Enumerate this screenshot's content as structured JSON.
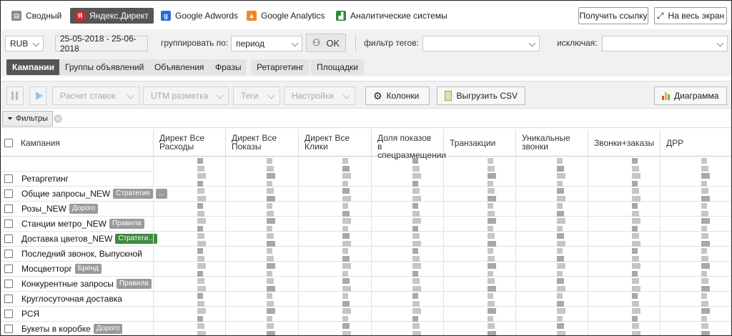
{
  "sources": {
    "tabs": [
      {
        "label": "Сводный",
        "icon": "summary-icon"
      },
      {
        "label": "Яндекс.Директ",
        "icon": "yandex-icon"
      },
      {
        "label": "Google Adwords",
        "icon": "google-icon"
      },
      {
        "label": "Google Analytics",
        "icon": "analytics-icon"
      },
      {
        "label": "Аналитические системы",
        "icon": "analytics-systems-icon"
      }
    ],
    "active": "Яндекс.Директ"
  },
  "header_buttons": {
    "get_link": "Получить ссылку",
    "fullscreen": "На весь экран"
  },
  "filters": {
    "currency": "RUB",
    "date_range": "25-05-2018 - 25-06-2018",
    "group_by_label": "группировать по:",
    "group_by_value": "период",
    "ok_label": "OK",
    "tag_filter_label": "фильтр тегов:",
    "tag_filter_value": "",
    "exclude_label": "исключая:",
    "exclude_value": ""
  },
  "subtabs": {
    "items": [
      "Кампании",
      "Группы объявлений",
      "Объявления",
      "Фразы",
      "Ретаргетинг",
      "Площадки"
    ],
    "active": "Кампании"
  },
  "toolbar": {
    "bid_calc": "Расчет ставок",
    "utm": "UTM разметка",
    "tags": "Теги",
    "settings": "Настройки",
    "columns": "Колонки",
    "export_csv": "Выгрузить CSV",
    "chart": "Диаграмма"
  },
  "filter_chip": {
    "label": "Фильтры"
  },
  "table": {
    "columns": [
      "Кампания",
      "Директ Все Расходы",
      "Директ Все Показы",
      "Директ Все Клики",
      "Доля показов в спецразмещении",
      "Транзакции",
      "Уникальные звонки",
      "Звонки+заказы",
      "ДРР"
    ],
    "rows": [
      {
        "name": "Ретаргетинг",
        "badge": ""
      },
      {
        "name": "Общие запросы_NEW",
        "badge": "Стратегия",
        "badge2": "..."
      },
      {
        "name": "Розы_NEW",
        "badge": "Дорого"
      },
      {
        "name": "Станции метро_NEW",
        "badge": "Правила"
      },
      {
        "name": "Доставка цветов_NEW",
        "badge": "Стратеги...",
        "badge_color": "#3f8a3f"
      },
      {
        "name": "Последний звонок, Выпускной",
        "badge": ""
      },
      {
        "name": "Мосцветторг",
        "badge": "Бренд"
      },
      {
        "name": "Конкурентные запросы",
        "badge": "Правила"
      },
      {
        "name": "Круглосуточная доставка",
        "badge": ""
      },
      {
        "name": "РСЯ",
        "badge": ""
      },
      {
        "name": "Букеты в коробке",
        "badge": "Дорого"
      }
    ]
  },
  "colors": {
    "active_tab": "#555555",
    "green_badge": "#3f8a3f",
    "grey_badge": "#9a9a9a"
  }
}
